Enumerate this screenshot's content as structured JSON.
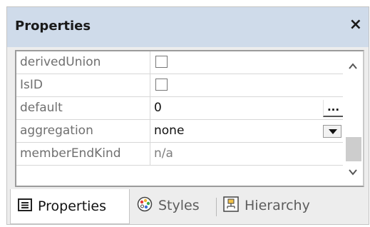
{
  "window": {
    "title": "Properties",
    "close": "×"
  },
  "properties": [
    {
      "name": "derivedUnion",
      "type": "checkbox",
      "checked": false
    },
    {
      "name": "IsID",
      "type": "checkbox",
      "checked": false
    },
    {
      "name": "default",
      "type": "text",
      "value": "0",
      "button": "..."
    },
    {
      "name": "aggregation",
      "type": "dropdown",
      "value": "none"
    },
    {
      "name": "memberEndKind",
      "type": "readonly",
      "value": "n/a"
    }
  ],
  "tabs": [
    {
      "label": "Properties",
      "icon": "properties-icon",
      "active": true
    },
    {
      "label": "Styles",
      "icon": "palette-icon",
      "active": false
    },
    {
      "label": "Hierarchy",
      "icon": "hierarchy-icon",
      "active": false
    }
  ],
  "colors": {
    "titlebar": "#cfdbea",
    "panel": "#ededed",
    "thumb": "#cdcdcd"
  }
}
